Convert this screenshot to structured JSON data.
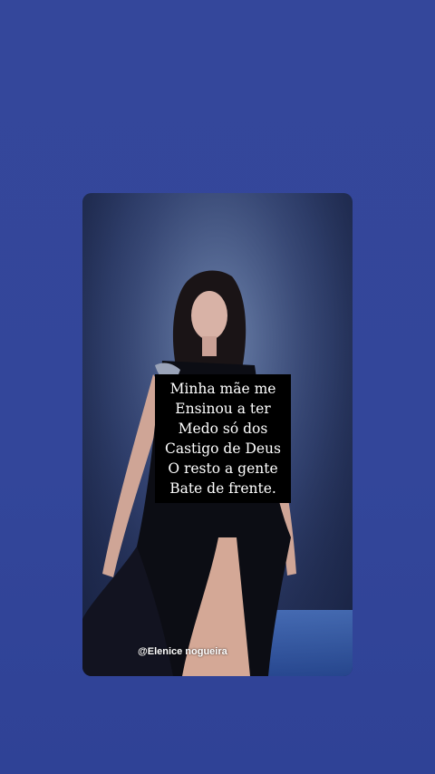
{
  "story": {
    "quote_lines": [
      "Minha mãe me",
      "Ensinou a ter",
      "Medo só dos",
      "Castigo de Deus",
      "O resto a gente",
      "Bate de frente."
    ],
    "handle": "@Elenice nogueira"
  },
  "colors": {
    "background": "#34479a",
    "quote_box": "#000000",
    "quote_text": "#ffffff"
  }
}
